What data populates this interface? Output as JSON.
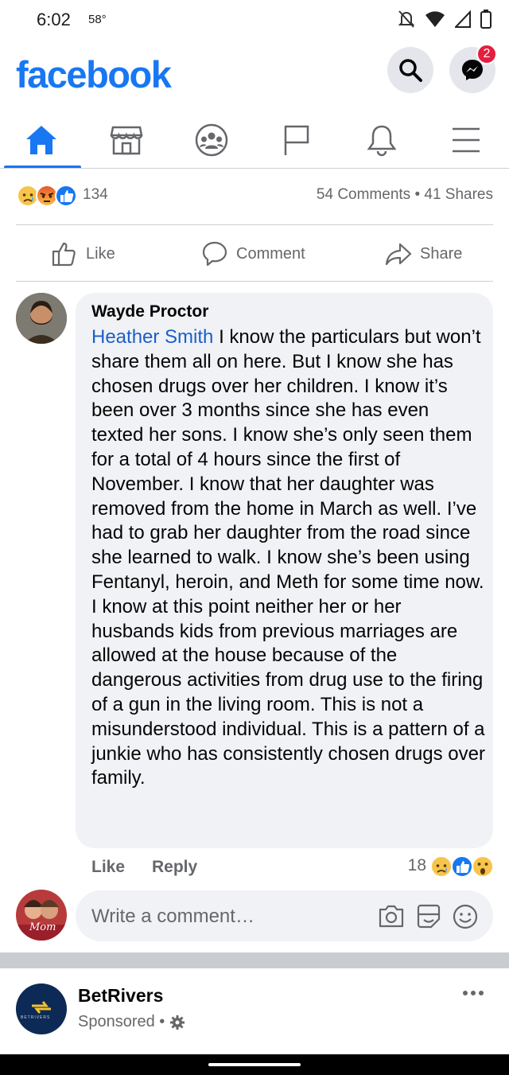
{
  "status_bar": {
    "time": "6:02",
    "temp": "58°"
  },
  "header": {
    "logo": "facebook",
    "messenger_badge": "2"
  },
  "nav": [
    "home-icon",
    "marketplace-icon",
    "groups-icon",
    "pages-icon",
    "notifications-icon",
    "menu-icon"
  ],
  "post_stats": {
    "reaction_count": "134",
    "comments_shares": "54 Comments • 41 Shares"
  },
  "actions": {
    "like": "Like",
    "comment": "Comment",
    "share": "Share"
  },
  "comment": {
    "author": "Wayde Proctor",
    "tagged": "Heather Smith",
    "text": " I know the particulars but won’t share them all on here. But I know she has chosen drugs over her children. I know it’s been over 3 months since she has even texted her sons. I know she’s only seen them for a total of 4 hours since the first of November. I know that her daughter was removed from the home in March as well. I’ve had to grab her daughter from the road since she learned to walk. I know she’s been using Fentanyl, heroin, and Meth for some time now. I know at this point neither her or her husbands kids from previous marriages are allowed at the house because of the dangerous activities from drug use to the firing of a gun in the living room. This is not a misunderstood individual. This is a pattern of a junkie who has consistently chosen drugs over family.",
    "like": "Like",
    "reply": "Reply",
    "reaction_count": "18"
  },
  "composer": {
    "placeholder": "Write a comment…",
    "avatar_text": "Mom"
  },
  "sponsored": {
    "name": "BetRivers",
    "label": "Sponsored •",
    "logo_text": "BETRIVERS"
  }
}
